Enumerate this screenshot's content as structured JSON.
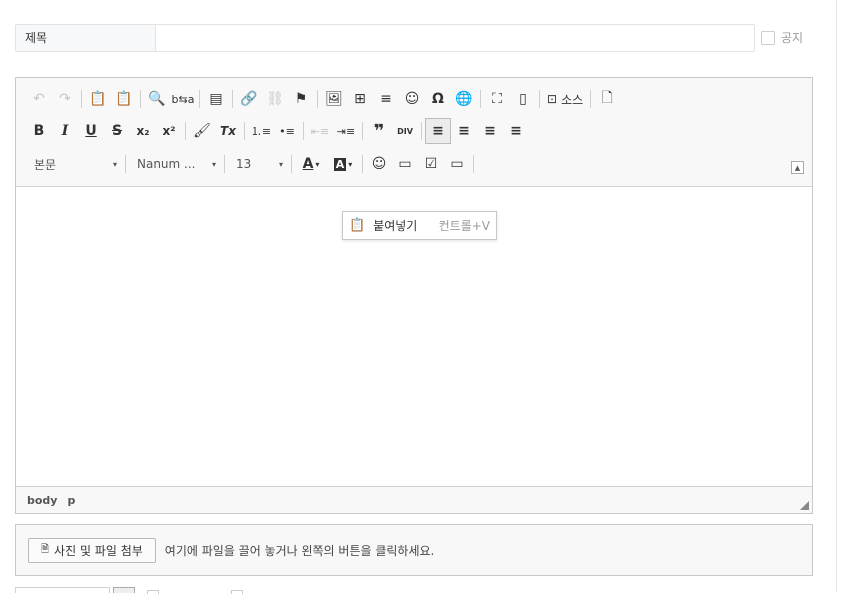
{
  "title_field": {
    "label": "제목",
    "value": ""
  },
  "notice": {
    "label": "공지",
    "checked": false
  },
  "editor": {
    "toolbar": {
      "row1": {
        "undo_icon": "↶",
        "redo_icon": "↷",
        "paste_text_icon": "📋",
        "paste_word_icon": "📋",
        "find_icon": "🔍",
        "replace_icon": "b⇆a",
        "template_icon": "▤",
        "link_icon": "🔗",
        "unlink_icon": "⛓",
        "anchor_icon": "⚑",
        "image_icon": "🖼",
        "table_icon": "⊞",
        "hr_icon": "≡",
        "smiley_icon": "☺",
        "special_char_icon": "Ω",
        "iframe_icon": "🌐",
        "maximize_icon": "⛶",
        "show_blocks_icon": "▯",
        "source_icon": "⊡",
        "source_label": "소스",
        "new_page_icon": "🗋"
      },
      "row2": {
        "bold": "B",
        "italic": "I",
        "underline": "U",
        "strike": "S",
        "subscript": "x₂",
        "superscript": "x²",
        "copy_format_icon": "🖌",
        "remove_format": "Tx",
        "numbered_list_icon": "⒈≡",
        "bulleted_list_icon": "•≡",
        "outdent_icon": "⇤≡",
        "indent_icon": "⇥≡",
        "blockquote": "❞",
        "div_icon": "DIV",
        "align_left_icon": "≡",
        "align_center_icon": "≡",
        "align_right_icon": "≡",
        "justify_icon": "≡"
      },
      "row3": {
        "format_value": "본문",
        "font_value": "Nanum ...",
        "size_value": "13",
        "text_color_icon": "A",
        "bg_color_icon": "A",
        "emoji_icon": "☺",
        "image_gallery_icon": "▭",
        "checkbox_icon": "☑",
        "image_gallery2_icon": "▭"
      },
      "dropdown_arrow": "▾",
      "collapse_icon": "▲"
    },
    "context_menu": {
      "icon": "📋",
      "label": "붙여넣기",
      "shortcut": "컨트롤+V"
    },
    "status_path": [
      "body",
      "p"
    ]
  },
  "attach": {
    "button_icon": "🗎",
    "button_label": "사진 및 파일 첨부",
    "hint": "여기에 파일을 끌어 놓거나 왼쪽의 버튼을 클릭하세요."
  }
}
